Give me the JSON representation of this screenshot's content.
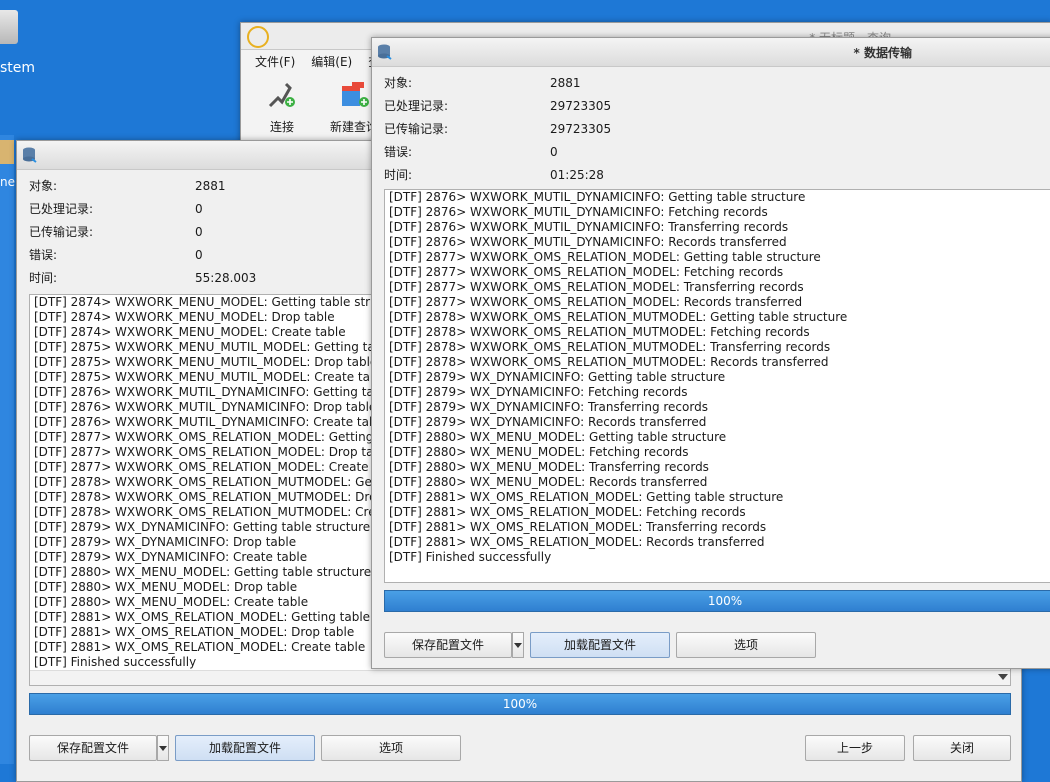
{
  "desktop": {
    "label": "stem",
    "label2": "ne"
  },
  "app": {
    "title": "* 无标题 - 查询",
    "menu": [
      "文件(F)",
      "编辑(E)",
      "查"
    ],
    "tools": [
      "连接",
      "新建查询"
    ]
  },
  "win_back": {
    "labels": [
      "对象:",
      "已处理记录:",
      "已传输记录:",
      "错误:",
      "时间:"
    ],
    "values": [
      "2881",
      "0",
      "0",
      "0",
      "55:28.003"
    ],
    "log": [
      "[DTF] 2874> WXWORK_MENU_MODEL: Getting table structure",
      "[DTF] 2874> WXWORK_MENU_MODEL: Drop table",
      "[DTF] 2874> WXWORK_MENU_MODEL: Create table",
      "[DTF] 2875> WXWORK_MENU_MUTIL_MODEL: Getting table structure",
      "[DTF] 2875> WXWORK_MENU_MUTIL_MODEL: Drop table",
      "[DTF] 2875> WXWORK_MENU_MUTIL_MODEL: Create table",
      "[DTF] 2876> WXWORK_MUTIL_DYNAMICINFO: Getting table structure",
      "[DTF] 2876> WXWORK_MUTIL_DYNAMICINFO: Drop table",
      "[DTF] 2876> WXWORK_MUTIL_DYNAMICINFO: Create table",
      "[DTF] 2877> WXWORK_OMS_RELATION_MODEL: Getting table structure",
      "[DTF] 2877> WXWORK_OMS_RELATION_MODEL: Drop table",
      "[DTF] 2877> WXWORK_OMS_RELATION_MODEL: Create table",
      "[DTF] 2878> WXWORK_OMS_RELATION_MUTMODEL: Getting table structure",
      "[DTF] 2878> WXWORK_OMS_RELATION_MUTMODEL: Drop table",
      "[DTF] 2878> WXWORK_OMS_RELATION_MUTMODEL: Create table",
      "[DTF] 2879> WX_DYNAMICINFO: Getting table structure",
      "[DTF] 2879> WX_DYNAMICINFO: Drop table",
      "[DTF] 2879> WX_DYNAMICINFO: Create table",
      "[DTF] 2880> WX_MENU_MODEL: Getting table structure",
      "[DTF] 2880> WX_MENU_MODEL: Drop table",
      "[DTF] 2880> WX_MENU_MODEL: Create table",
      "[DTF] 2881> WX_OMS_RELATION_MODEL: Getting table structure",
      "[DTF] 2881> WX_OMS_RELATION_MODEL: Drop table",
      "[DTF] 2881> WX_OMS_RELATION_MODEL: Create table",
      "[DTF] Finished successfully"
    ],
    "progress": "100%",
    "buttons": {
      "save": "保存配置文件",
      "load": "加载配置文件",
      "options": "选项",
      "back": "上一步",
      "close": "关闭"
    }
  },
  "win_front": {
    "title": "* 数据传输",
    "labels": [
      "对象:",
      "已处理记录:",
      "已传输记录:",
      "错误:",
      "时间:"
    ],
    "values": [
      "2881",
      "29723305",
      "29723305",
      "0",
      "01:25:28"
    ],
    "log": [
      "[DTF] 2876> WXWORK_MUTIL_DYNAMICINFO: Getting table structure",
      "[DTF] 2876> WXWORK_MUTIL_DYNAMICINFO: Fetching records",
      "[DTF] 2876> WXWORK_MUTIL_DYNAMICINFO: Transferring records",
      "[DTF] 2876> WXWORK_MUTIL_DYNAMICINFO: Records transferred",
      "[DTF] 2877> WXWORK_OMS_RELATION_MODEL: Getting table structure",
      "[DTF] 2877> WXWORK_OMS_RELATION_MODEL: Fetching records",
      "[DTF] 2877> WXWORK_OMS_RELATION_MODEL: Transferring records",
      "[DTF] 2877> WXWORK_OMS_RELATION_MODEL: Records transferred",
      "[DTF] 2878> WXWORK_OMS_RELATION_MUTMODEL: Getting table structure",
      "[DTF] 2878> WXWORK_OMS_RELATION_MUTMODEL: Fetching records",
      "[DTF] 2878> WXWORK_OMS_RELATION_MUTMODEL: Transferring records",
      "[DTF] 2878> WXWORK_OMS_RELATION_MUTMODEL: Records transferred",
      "[DTF] 2879> WX_DYNAMICINFO: Getting table structure",
      "[DTF] 2879> WX_DYNAMICINFO: Fetching records",
      "[DTF] 2879> WX_DYNAMICINFO: Transferring records",
      "[DTF] 2879> WX_DYNAMICINFO: Records transferred",
      "[DTF] 2880> WX_MENU_MODEL: Getting table structure",
      "[DTF] 2880> WX_MENU_MODEL: Fetching records",
      "[DTF] 2880> WX_MENU_MODEL: Transferring records",
      "[DTF] 2880> WX_MENU_MODEL: Records transferred",
      "[DTF] 2881> WX_OMS_RELATION_MODEL: Getting table structure",
      "[DTF] 2881> WX_OMS_RELATION_MODEL: Fetching records",
      "[DTF] 2881> WX_OMS_RELATION_MODEL: Transferring records",
      "[DTF] 2881> WX_OMS_RELATION_MODEL: Records transferred",
      "[DTF] Finished successfully"
    ],
    "progress": "100%",
    "buttons": {
      "save": "保存配置文件",
      "load": "加载配置文件",
      "options": "选项"
    }
  },
  "colors": {
    "desktop": "#1e78d6",
    "progress": "#3a8ede",
    "window": "#f0f0f0"
  }
}
